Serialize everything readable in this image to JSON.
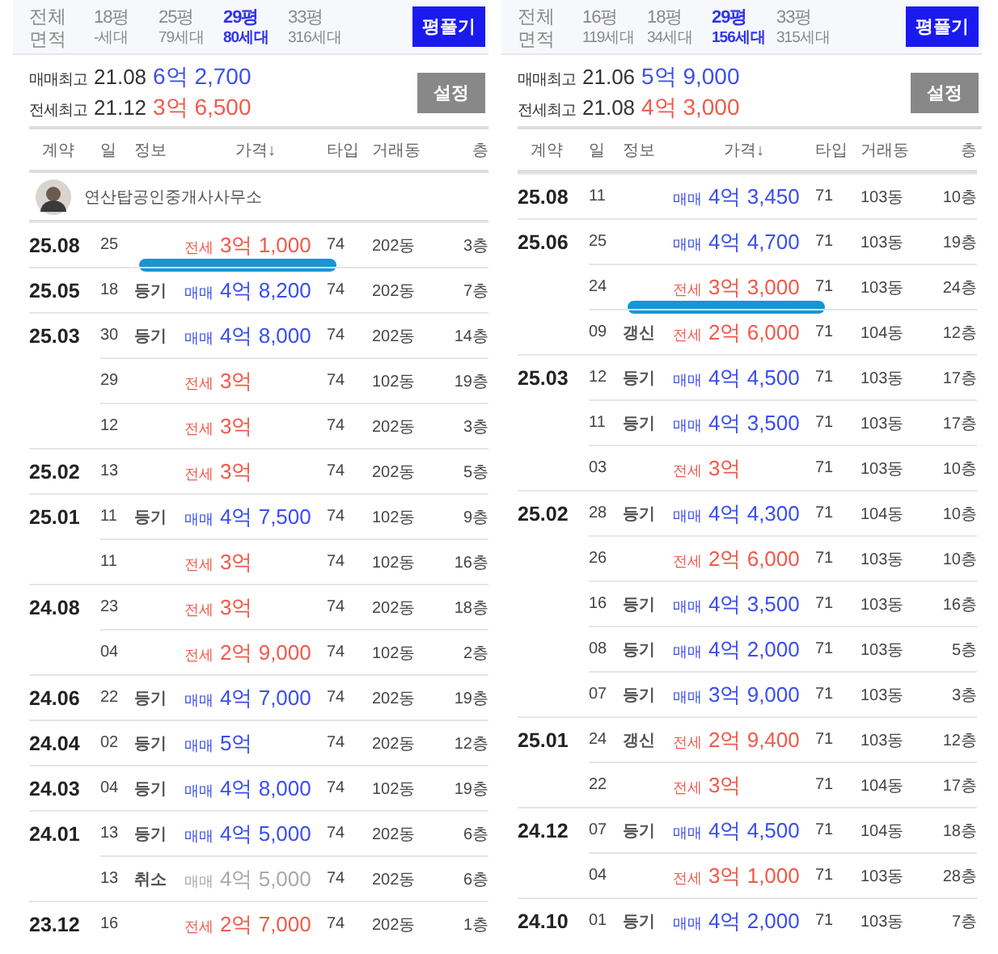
{
  "panels": [
    {
      "sizes": {
        "row_label_1": "전체",
        "row_label_2": "면적",
        "items": [
          {
            "size": "18평",
            "units": "-세대",
            "selected": false
          },
          {
            "size": "25평",
            "units": "79세대",
            "selected": false
          },
          {
            "size": "29평",
            "units": "80세대",
            "selected": true
          },
          {
            "size": "33평",
            "units": "316세대",
            "selected": false
          }
        ],
        "toggle_button": "평풀기"
      },
      "summary": {
        "sale_label": "매매최고",
        "sale_date": "21.08",
        "sale_price": "6억 2,700",
        "jeonse_label": "전세최고",
        "jeonse_date": "21.12",
        "jeonse_price": "3억 6,500",
        "settings_button": "설정"
      },
      "columns": [
        "계약",
        "일",
        "정보",
        "가격↓",
        "타입",
        "거래동",
        "층"
      ],
      "agent": {
        "name": "연산탑공인중개사사무소"
      },
      "rows": [
        {
          "date": "25.08",
          "day": "25",
          "info": "",
          "kind": "jeonse",
          "deal": "전세",
          "price": "3억 1,000",
          "type": "74",
          "building": "202동",
          "floor": "3층",
          "cancelled": false,
          "marked": true
        },
        {
          "date": "25.05",
          "day": "18",
          "info": "등기",
          "kind": "sale",
          "deal": "매매",
          "price": "4억 8,200",
          "type": "74",
          "building": "202동",
          "floor": "7층",
          "cancelled": false,
          "marked": false
        },
        {
          "date": "25.03",
          "day": "30",
          "info": "등기",
          "kind": "sale",
          "deal": "매매",
          "price": "4억 8,000",
          "type": "74",
          "building": "202동",
          "floor": "14층",
          "cancelled": false,
          "marked": false
        },
        {
          "date": "",
          "day": "29",
          "info": "",
          "kind": "jeonse",
          "deal": "전세",
          "price": "3억",
          "type": "74",
          "building": "102동",
          "floor": "19층",
          "cancelled": false,
          "marked": false
        },
        {
          "date": "",
          "day": "12",
          "info": "",
          "kind": "jeonse",
          "deal": "전세",
          "price": "3억",
          "type": "74",
          "building": "202동",
          "floor": "3층",
          "cancelled": false,
          "marked": false
        },
        {
          "date": "25.02",
          "day": "13",
          "info": "",
          "kind": "jeonse",
          "deal": "전세",
          "price": "3억",
          "type": "74",
          "building": "202동",
          "floor": "5층",
          "cancelled": false,
          "marked": false
        },
        {
          "date": "25.01",
          "day": "11",
          "info": "등기",
          "kind": "sale",
          "deal": "매매",
          "price": "4억 7,500",
          "type": "74",
          "building": "102동",
          "floor": "9층",
          "cancelled": false,
          "marked": false
        },
        {
          "date": "",
          "day": "11",
          "info": "",
          "kind": "jeonse",
          "deal": "전세",
          "price": "3억",
          "type": "74",
          "building": "102동",
          "floor": "16층",
          "cancelled": false,
          "marked": false
        },
        {
          "date": "24.08",
          "day": "23",
          "info": "",
          "kind": "jeonse",
          "deal": "전세",
          "price": "3억",
          "type": "74",
          "building": "202동",
          "floor": "18층",
          "cancelled": false,
          "marked": false
        },
        {
          "date": "",
          "day": "04",
          "info": "",
          "kind": "jeonse",
          "deal": "전세",
          "price": "2억 9,000",
          "type": "74",
          "building": "102동",
          "floor": "2층",
          "cancelled": false,
          "marked": false
        },
        {
          "date": "24.06",
          "day": "22",
          "info": "등기",
          "kind": "sale",
          "deal": "매매",
          "price": "4억 7,000",
          "type": "74",
          "building": "202동",
          "floor": "19층",
          "cancelled": false,
          "marked": false
        },
        {
          "date": "24.04",
          "day": "02",
          "info": "등기",
          "kind": "sale",
          "deal": "매매",
          "price": "5억",
          "type": "74",
          "building": "202동",
          "floor": "12층",
          "cancelled": false,
          "marked": false
        },
        {
          "date": "24.03",
          "day": "04",
          "info": "등기",
          "kind": "sale",
          "deal": "매매",
          "price": "4억 8,000",
          "type": "74",
          "building": "102동",
          "floor": "19층",
          "cancelled": false,
          "marked": false
        },
        {
          "date": "24.01",
          "day": "13",
          "info": "등기",
          "kind": "sale",
          "deal": "매매",
          "price": "4억 5,000",
          "type": "74",
          "building": "202동",
          "floor": "6층",
          "cancelled": false,
          "marked": false
        },
        {
          "date": "",
          "day": "13",
          "info": "취소",
          "kind": "sale",
          "deal": "매매",
          "price": "4억 5,000",
          "type": "74",
          "building": "202동",
          "floor": "6층",
          "cancelled": true,
          "marked": false
        },
        {
          "date": "23.12",
          "day": "16",
          "info": "",
          "kind": "jeonse",
          "deal": "전세",
          "price": "2억 7,000",
          "type": "74",
          "building": "202동",
          "floor": "1층",
          "cancelled": false,
          "marked": false
        }
      ]
    },
    {
      "sizes": {
        "row_label_1": "전체",
        "row_label_2": "면적",
        "items": [
          {
            "size": "16평",
            "units": "119세대",
            "selected": false
          },
          {
            "size": "18평",
            "units": "34세대",
            "selected": false
          },
          {
            "size": "29평",
            "units": "156세대",
            "selected": true
          },
          {
            "size": "33평",
            "units": "315세대",
            "selected": false
          }
        ],
        "toggle_button": "평풀기"
      },
      "summary": {
        "sale_label": "매매최고",
        "sale_date": "21.06",
        "sale_price": "5억 9,000",
        "jeonse_label": "전세최고",
        "jeonse_date": "21.08",
        "jeonse_price": "4억 3,000",
        "settings_button": "설정"
      },
      "columns": [
        "계약",
        "일",
        "정보",
        "가격↓",
        "타입",
        "거래동",
        "층"
      ],
      "rows": [
        {
          "date": "25.08",
          "day": "11",
          "info": "",
          "kind": "sale",
          "deal": "매매",
          "price": "4억 3,450",
          "type": "71",
          "building": "103동",
          "floor": "10층",
          "cancelled": false,
          "marked": false
        },
        {
          "date": "25.06",
          "day": "25",
          "info": "",
          "kind": "sale",
          "deal": "매매",
          "price": "4억 4,700",
          "type": "71",
          "building": "103동",
          "floor": "19층",
          "cancelled": false,
          "marked": false
        },
        {
          "date": "",
          "day": "24",
          "info": "",
          "kind": "jeonse",
          "deal": "전세",
          "price": "3억 3,000",
          "type": "71",
          "building": "103동",
          "floor": "24층",
          "cancelled": false,
          "marked": true
        },
        {
          "date": "",
          "day": "09",
          "info": "갱신",
          "kind": "jeonse",
          "deal": "전세",
          "price": "2억 6,000",
          "type": "71",
          "building": "104동",
          "floor": "12층",
          "cancelled": false,
          "marked": false
        },
        {
          "date": "25.03",
          "day": "12",
          "info": "등기",
          "kind": "sale",
          "deal": "매매",
          "price": "4억 4,500",
          "type": "71",
          "building": "103동",
          "floor": "17층",
          "cancelled": false,
          "marked": false
        },
        {
          "date": "",
          "day": "11",
          "info": "등기",
          "kind": "sale",
          "deal": "매매",
          "price": "4억 3,500",
          "type": "71",
          "building": "103동",
          "floor": "17층",
          "cancelled": false,
          "marked": false
        },
        {
          "date": "",
          "day": "03",
          "info": "",
          "kind": "jeonse",
          "deal": "전세",
          "price": "3억",
          "type": "71",
          "building": "103동",
          "floor": "10층",
          "cancelled": false,
          "marked": false
        },
        {
          "date": "25.02",
          "day": "28",
          "info": "등기",
          "kind": "sale",
          "deal": "매매",
          "price": "4억 4,300",
          "type": "71",
          "building": "104동",
          "floor": "10층",
          "cancelled": false,
          "marked": false
        },
        {
          "date": "",
          "day": "26",
          "info": "",
          "kind": "jeonse",
          "deal": "전세",
          "price": "2억 6,000",
          "type": "71",
          "building": "103동",
          "floor": "10층",
          "cancelled": false,
          "marked": false
        },
        {
          "date": "",
          "day": "16",
          "info": "등기",
          "kind": "sale",
          "deal": "매매",
          "price": "4억 3,500",
          "type": "71",
          "building": "103동",
          "floor": "16층",
          "cancelled": false,
          "marked": false
        },
        {
          "date": "",
          "day": "08",
          "info": "등기",
          "kind": "sale",
          "deal": "매매",
          "price": "4억 2,000",
          "type": "71",
          "building": "103동",
          "floor": "5층",
          "cancelled": false,
          "marked": false
        },
        {
          "date": "",
          "day": "07",
          "info": "등기",
          "kind": "sale",
          "deal": "매매",
          "price": "3억 9,000",
          "type": "71",
          "building": "103동",
          "floor": "3층",
          "cancelled": false,
          "marked": false
        },
        {
          "date": "25.01",
          "day": "24",
          "info": "갱신",
          "kind": "jeonse",
          "deal": "전세",
          "price": "2억 9,400",
          "type": "71",
          "building": "103동",
          "floor": "12층",
          "cancelled": false,
          "marked": false
        },
        {
          "date": "",
          "day": "22",
          "info": "",
          "kind": "jeonse",
          "deal": "전세",
          "price": "3억",
          "type": "71",
          "building": "104동",
          "floor": "17층",
          "cancelled": false,
          "marked": false
        },
        {
          "date": "24.12",
          "day": "07",
          "info": "등기",
          "kind": "sale",
          "deal": "매매",
          "price": "4억 4,500",
          "type": "71",
          "building": "104동",
          "floor": "18층",
          "cancelled": false,
          "marked": false
        },
        {
          "date": "",
          "day": "04",
          "info": "",
          "kind": "jeonse",
          "deal": "전세",
          "price": "3억 1,000",
          "type": "71",
          "building": "103동",
          "floor": "28층",
          "cancelled": false,
          "marked": false
        },
        {
          "date": "24.10",
          "day": "01",
          "info": "등기",
          "kind": "sale",
          "deal": "매매",
          "price": "4억 2,000",
          "type": "71",
          "building": "103동",
          "floor": "7층",
          "cancelled": false,
          "marked": false
        }
      ]
    }
  ]
}
